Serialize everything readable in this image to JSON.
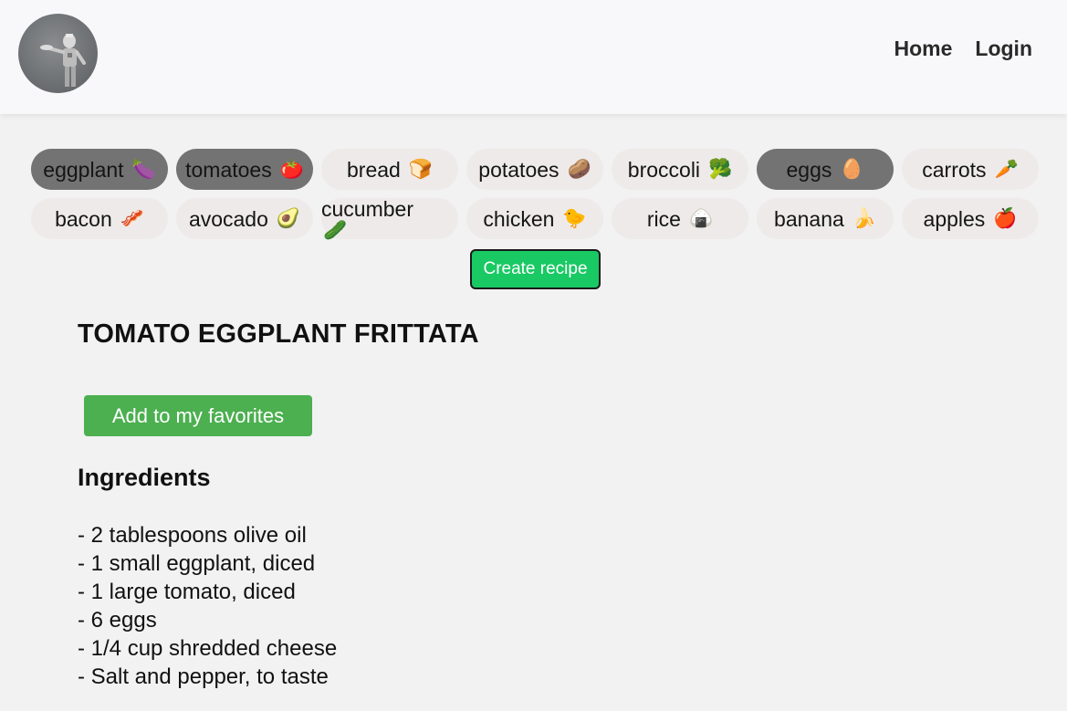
{
  "header": {
    "nav": [
      {
        "label": "Home"
      },
      {
        "label": "Login"
      }
    ]
  },
  "ingredients_picker": {
    "chips": [
      {
        "label": "eggplant",
        "emoji": "🍆",
        "selected": true
      },
      {
        "label": "tomatoes",
        "emoji": "🍅",
        "selected": true
      },
      {
        "label": "bread",
        "emoji": "🍞",
        "selected": false
      },
      {
        "label": "potatoes",
        "emoji": "🥔",
        "selected": false
      },
      {
        "label": "broccoli",
        "emoji": "🥦",
        "selected": false
      },
      {
        "label": "eggs",
        "emoji": "🥚",
        "selected": true
      },
      {
        "label": "carrots",
        "emoji": "🥕",
        "selected": false
      },
      {
        "label": "bacon",
        "emoji": "🥓",
        "selected": false
      },
      {
        "label": "avocado",
        "emoji": "🥑",
        "selected": false
      },
      {
        "label": "cucumber",
        "emoji": "🥒",
        "selected": false
      },
      {
        "label": "chicken",
        "emoji": "🐤",
        "selected": false
      },
      {
        "label": "rice",
        "emoji": "🍙",
        "selected": false
      },
      {
        "label": "banana",
        "emoji": "🍌",
        "selected": false
      },
      {
        "label": "apples",
        "emoji": "🍎",
        "selected": false
      }
    ],
    "create_label": "Create recipe"
  },
  "recipe": {
    "title": "TOMATO EGGPLANT FRITTATA",
    "favorite_label": "Add to my favorites",
    "ingredients_heading": "Ingredients",
    "ingredients": [
      "- 2 tablespoons olive oil",
      "- 1 small eggplant, diced",
      "- 1 large tomato, diced",
      "- 6 eggs",
      "- 1/4 cup shredded cheese",
      "- Salt and pepper, to taste"
    ]
  },
  "colors": {
    "selected_chip": "#737373",
    "chip": "#eeeaea",
    "create_button": "#19c964",
    "favorite_button": "#4caf50"
  }
}
